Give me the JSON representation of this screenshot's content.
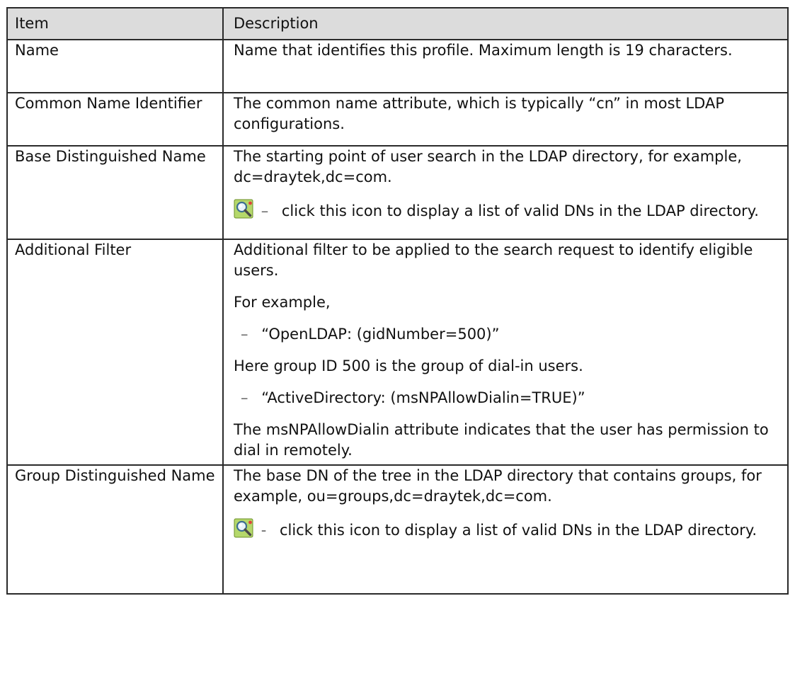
{
  "table": {
    "headers": {
      "item": "Item",
      "description": "Description"
    },
    "rows": [
      {
        "item": "Name",
        "paragraphs": [
          "Name that identifies this profile. Maximum length is 19 characters."
        ]
      },
      {
        "item": "Common Name Identifier",
        "paragraphs": [
          "The common name attribute, which is typically “cn” in most LDAP configurations."
        ]
      },
      {
        "item": "Base Distinguished Name",
        "paragraphs": [
          "The starting point of user search in the LDAP directory, for example, dc=draytek,dc=com."
        ],
        "icon_note": {
          "icon": "ldap-search-icon",
          "dash": "–",
          "text": "click this icon to display a list of valid DNs in the LDAP directory."
        }
      },
      {
        "item": "Additional Filter",
        "paragraphs": [
          "Additional filter to be applied to the search request to identify eligible users.",
          "For example,"
        ],
        "bullet_1": {
          "dash": "–",
          "text": "“OpenLDAP: (gidNumber=500)”"
        },
        "paragraph_3": "Here group ID 500 is the group of dial-in users.",
        "bullet_2": {
          "dash": "–",
          "text": "“ActiveDirectory: (msNPAllowDialin=TRUE)”"
        },
        "paragraph_4": "The msNPAllowDialin attribute indicates that the user has permission to dial in remotely."
      },
      {
        "item": "Group Distinguished Name",
        "paragraphs": [
          "The base DN of the tree in the LDAP directory that contains groups, for example, ou=groups,dc=draytek,dc=com."
        ],
        "icon_note": {
          "icon": "ldap-search-icon",
          "dash": "-",
          "text": "click this icon to display a list of valid DNs in the LDAP directory."
        }
      }
    ]
  }
}
